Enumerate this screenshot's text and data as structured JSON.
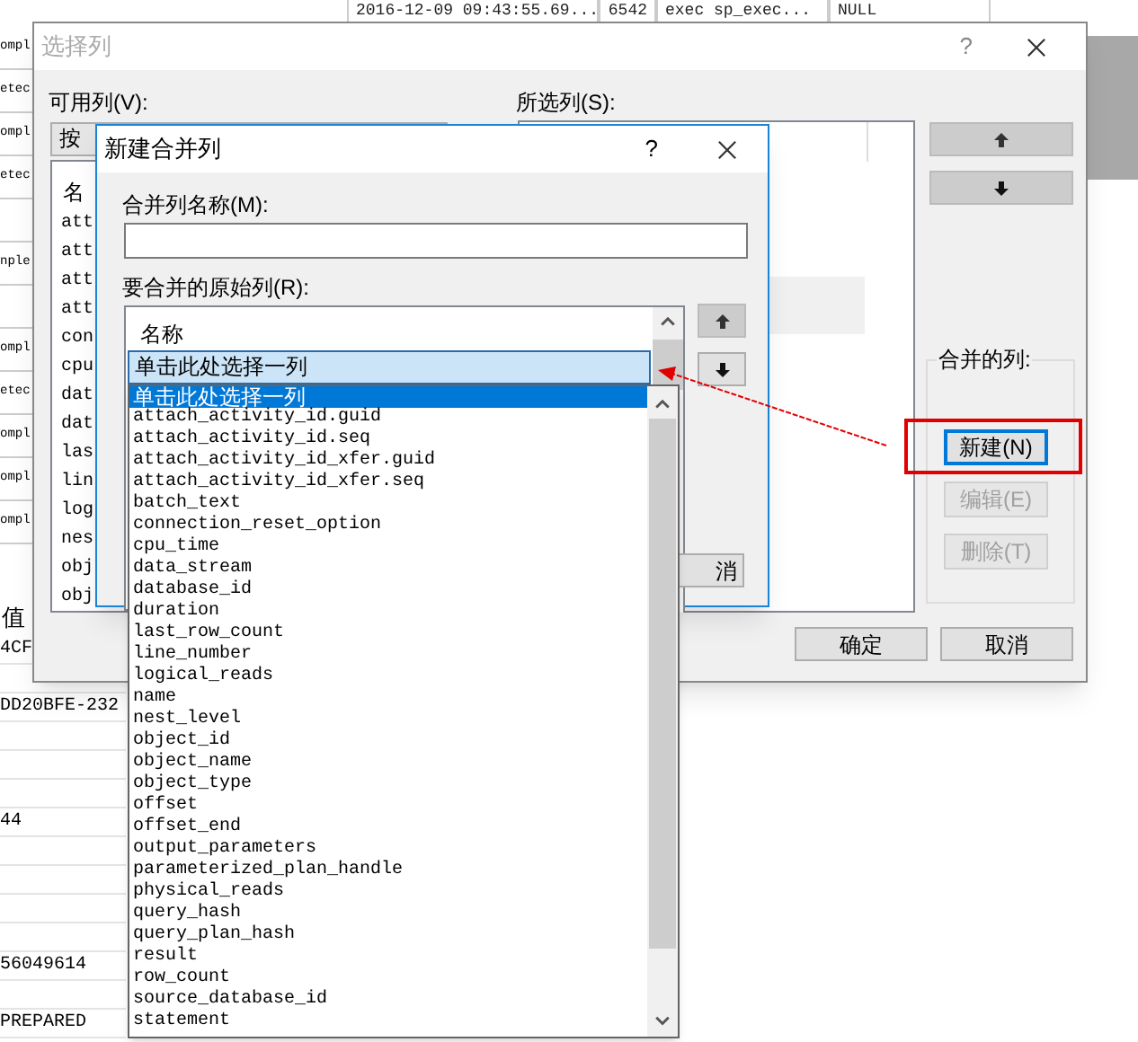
{
  "background_table": {
    "top_row": [
      "2016-12-09 09:43:55.69...",
      "6542",
      "exec sp_exec...",
      "NULL"
    ],
    "left_cells": [
      {
        "text": "ompl"
      },
      {
        "text": "etec"
      },
      {
        "text": "ompl"
      },
      {
        "text": "etec"
      },
      {},
      {
        "text": "nple"
      },
      {},
      {
        "text": "ompl"
      },
      {
        "text": "etec"
      },
      {
        "text": "ompl"
      },
      {
        "text": "ompl"
      },
      {
        "text": "ompl"
      }
    ],
    "value_header": "值",
    "value_cells": [
      {
        "text": "4CF"
      },
      {},
      {
        "text": "DD20BFE-232"
      },
      {},
      {},
      {},
      {
        "text": "44"
      },
      {},
      {},
      {},
      {},
      {
        "text": "56049614"
      },
      {},
      {
        "text": "PREPARED"
      }
    ]
  },
  "select_columns_dialog": {
    "title": "选择列",
    "active": false,
    "help": "?",
    "available_label": "可用列(V):",
    "sort_dropdown": "按",
    "available_list": {
      "header": "名",
      "items": [
        "att",
        "att",
        "att",
        "att",
        "con",
        "cpu",
        "dat",
        "dat",
        "las",
        "lin",
        "log",
        "nes",
        "obj",
        "obj"
      ]
    },
    "selected_label": "所选列(S):",
    "merged_group": {
      "title": "合并的列:",
      "buttons": [
        {
          "label": "新建(N)",
          "disabled": false,
          "focused": true
        },
        {
          "label": "编辑(E)",
          "disabled": true,
          "focused": false
        },
        {
          "label": "删除(T)",
          "disabled": true,
          "focused": false
        }
      ]
    },
    "ok": "确定",
    "cancel": "取消"
  },
  "new_merge_dialog": {
    "title": "新建合并列",
    "help": "?",
    "name_label": "合并列名称(M):",
    "source_label": "要合并的原始列(R):",
    "list_header": "名称",
    "combo_value": "单击此处选择一列",
    "cancel_fragment": "消",
    "dropdown_items": [
      {
        "label": "单击此处选择一列",
        "selected": true
      },
      {
        "label": "attach_activity_id.guid",
        "selected": false
      },
      {
        "label": "attach_activity_id.seq",
        "selected": false
      },
      {
        "label": "attach_activity_id_xfer.guid",
        "selected": false
      },
      {
        "label": "attach_activity_id_xfer.seq",
        "selected": false
      },
      {
        "label": "batch_text",
        "selected": false
      },
      {
        "label": "connection_reset_option",
        "selected": false
      },
      {
        "label": "cpu_time",
        "selected": false
      },
      {
        "label": "data_stream",
        "selected": false
      },
      {
        "label": "database_id",
        "selected": false
      },
      {
        "label": "duration",
        "selected": false
      },
      {
        "label": "last_row_count",
        "selected": false
      },
      {
        "label": "line_number",
        "selected": false
      },
      {
        "label": "logical_reads",
        "selected": false
      },
      {
        "label": "name",
        "selected": false
      },
      {
        "label": "nest_level",
        "selected": false
      },
      {
        "label": "object_id",
        "selected": false
      },
      {
        "label": "object_name",
        "selected": false
      },
      {
        "label": "object_type",
        "selected": false
      },
      {
        "label": "offset",
        "selected": false
      },
      {
        "label": "offset_end",
        "selected": false
      },
      {
        "label": "output_parameters",
        "selected": false
      },
      {
        "label": "parameterized_plan_handle",
        "selected": false
      },
      {
        "label": "physical_reads",
        "selected": false
      },
      {
        "label": "query_hash",
        "selected": false
      },
      {
        "label": "query_plan_hash",
        "selected": false
      },
      {
        "label": "result",
        "selected": false
      },
      {
        "label": "row_count",
        "selected": false
      },
      {
        "label": "source_database_id",
        "selected": false
      },
      {
        "label": "statement",
        "selected": false
      }
    ]
  }
}
